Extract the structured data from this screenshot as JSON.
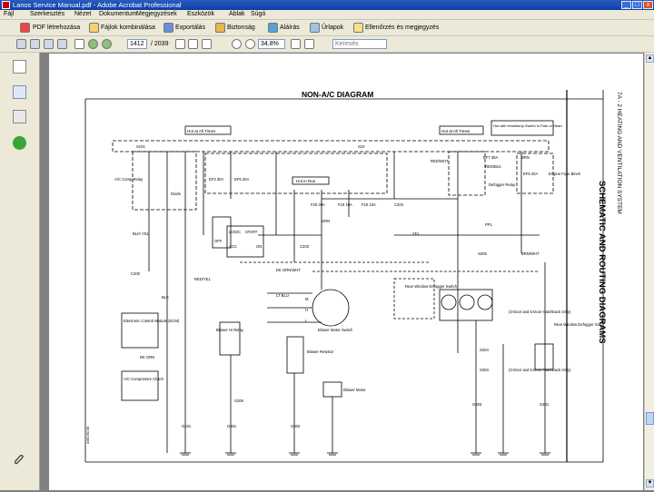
{
  "window": {
    "title": "Lanos Service Manual.pdf - Adobe Acrobat Professional",
    "buttons": [
      "_",
      "□",
      "x"
    ]
  },
  "menu": [
    "Fájl",
    "Szerkesztés",
    "Nézet",
    "Dokumentum",
    "Megjegyzések",
    "Eszközök",
    "Ablak",
    "Súgó"
  ],
  "toolbar1": {
    "pdf_create": "PDF létrehozása",
    "combine": "Fájlok kombinálása",
    "export": "Exportálás",
    "secure": "Biztonság",
    "sign": "Aláírás",
    "forms": "Űrlapok",
    "review": "Ellenőrzés és megjegyzés"
  },
  "toolbar2": {
    "page_current": "1412",
    "page_total": "/ 2039",
    "zoom": "34,8%",
    "search_placeholder": "Keresés"
  },
  "diagram": {
    "title": "NON-A/C DIAGRAM",
    "side_header": "7A - 2 HEATING AND VENTILATION SYSTEM",
    "side_title": "SCHEMATIC AND ROUTING DIAGRAMS",
    "boxes": {
      "hot_at_all_times": "Hot at All Times",
      "hot_at_all_times_2": "Hot at All Times",
      "hot_headlamp": "Hot with Headlamp Switch in Park or Head",
      "hot_in_run": "Hot in Run"
    },
    "labels": {
      "s101": "S101",
      "s10": "S10",
      "ef7": "EF7 30A",
      "ef3": "EF3 30A",
      "ef5": "EF5 20A",
      "ef6": "EF6 20A",
      "f20": "F20 20A",
      "f19": "F19 10A",
      "f15": "F15 10A",
      "fuse_block": "Engine Fuse Block",
      "relay_defog": "Defogger Relay",
      "red_wht": "RED/WHT",
      "red_blk": "RED/BLK",
      "blk_yel": "BLK/ YEL",
      "brn": "BRN",
      "ppl": "PPL",
      "yel": "YEL",
      "blk": "BLK",
      "lt_blu": "LT BLU",
      "dk_grn_wht": "DK GRN/WHT",
      "red_yel": "RED/YEL",
      "dk_grn": "DK GRN",
      "grn": "GRN",
      "brn_wht": "BRN/WHT",
      "c200": "C200",
      "c203": "C203",
      "c204": "C204",
      "s204": "S204",
      "s203": "S203",
      "s205": "S205",
      "s208": "S208",
      "g101": "G101",
      "g301": "G301",
      "g302": "G302",
      "g303": "G303",
      "g401": "G401",
      "blower_hi": "Blower Hi Relay",
      "blower_resistor": "Blower Resistor",
      "blower_switch": "Blower Motor Switch",
      "blower_motor": "Blower Motor",
      "rear_defog_switch": "Rear Window Defogger Switch",
      "rear_defog_grid": "Rear Window Defogger Grid",
      "ecm": "Electronic Control Module (ECM)",
      "compressor": "A/C Compressor Clutch",
      "ac_comp_relay": "A/C Comp Relay",
      "diode": "Diode",
      "logic": "LOGIC",
      "acc": "ACC",
      "on": "ON",
      "off": "OFF",
      "c_start": "START",
      "pin_m": "M",
      "pin_h": "H",
      "pin_l": "L",
      "hatchback": "(3-Door and 5-Door Hatchback Only)",
      "hatchback2": "(3-Door and 5-Door Hatchback Only)",
      "side_code": "A6E26D38"
    }
  }
}
